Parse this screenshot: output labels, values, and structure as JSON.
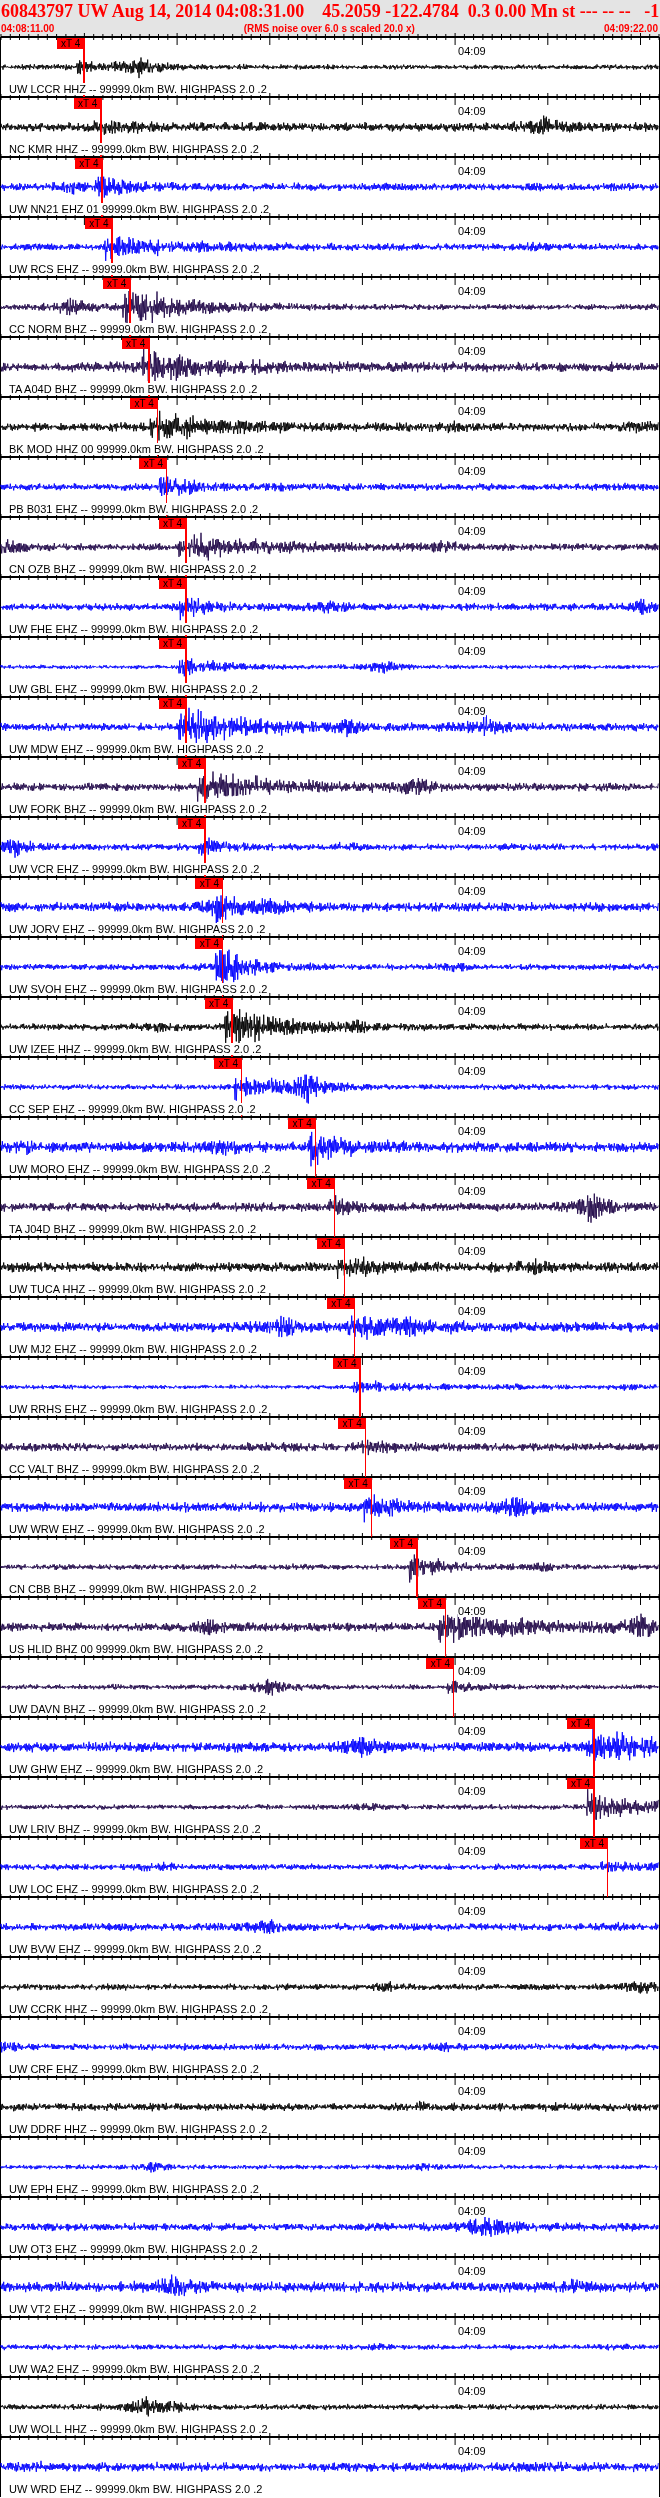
{
  "header": {
    "title": "60843797 UW Aug 14, 2014 04:08:31.00    45.2059 -122.4784  0.3 0.00 Mn st --- -- --   -1",
    "start_time": "04:08:11.00",
    "note": "(RMS noise over 6.0 s scaled 20.0 x)",
    "end_time": "04:09:22.00"
  },
  "traces": [
    {
      "label": "UW LCCR HHZ -- 99999.0km BW. HIGHPASS 2.0 .2",
      "color": "#000000",
      "time_mark": "04:09",
      "pick": {
        "label": "xT 4",
        "level": 0.127
      }
    },
    {
      "label": "NC KMR HHZ -- 99999.0km BW. HIGHPASS 2.0 .2",
      "color": "#000000",
      "time_mark": "04:09",
      "pick": {
        "label": "xT 4",
        "level": 0.153
      }
    },
    {
      "label": "UW NN21 EHZ 01 99999.0km BW. HIGHPASS 2.0 .2",
      "color": "#0000ff",
      "time_mark": "04:09",
      "pick": {
        "label": "xT 4",
        "level": 0.155
      }
    },
    {
      "label": "UW RCS EHZ -- 99999.0km BW. HIGHPASS 2.0 .2",
      "color": "#0000ff",
      "time_mark": "04:09",
      "pick": {
        "label": "xT 4",
        "level": 0.17
      }
    },
    {
      "label": "CC NORM BHZ -- 99999.0km BW. HIGHPASS 2.0 .2",
      "color": "#200848",
      "time_mark": "04:09",
      "pick": {
        "label": "xT 4",
        "level": 0.197
      }
    },
    {
      "label": "TA A04D BHZ -- 99999.0km BW. HIGHPASS 2.0 .2",
      "color": "#200848",
      "time_mark": "04:09",
      "pick": {
        "label": "xT 4",
        "level": 0.226
      }
    },
    {
      "label": "BK MOD HHZ 00 99999.0km BW. HIGHPASS 2.0 .2",
      "color": "#000000",
      "time_mark": "04:09",
      "pick": {
        "label": "xT 4",
        "level": 0.239
      }
    },
    {
      "label": "PB B031 EHZ -- 99999.0km BW. HIGHPASS 2.0 .2",
      "color": "#0000ff",
      "time_mark": "04:09",
      "pick": {
        "label": "xT 4",
        "level": 0.253
      }
    },
    {
      "label": "CN OZB BHZ -- 99999.0km BW. HIGHPASS 2.0 .2",
      "color": "#200848",
      "time_mark": "04:09",
      "pick": {
        "label": "xT 4",
        "level": 0.282
      }
    },
    {
      "label": "UW FHE EHZ -- 99999.0km BW. HIGHPASS 2.0 .2",
      "color": "#0000ff",
      "time_mark": "04:09",
      "pick": {
        "label": "xT 4",
        "level": 0.282
      }
    },
    {
      "label": "UW GBL EHZ -- 99999.0km BW. HIGHPASS 2.0 .2",
      "color": "#0000ff",
      "time_mark": "04:09",
      "pick": {
        "label": "xT 4",
        "level": 0.282
      }
    },
    {
      "label": "UW MDW EHZ -- 99999.0km BW. HIGHPASS 2.0 .2",
      "color": "#0000ff",
      "time_mark": "04:09",
      "pick": {
        "label": "xT 4",
        "level": 0.282
      }
    },
    {
      "label": "UW FORK BHZ -- 99999.0km BW. HIGHPASS 2.0 .2",
      "color": "#200848",
      "time_mark": "04:09",
      "pick": {
        "label": "xT 4",
        "level": 0.311
      }
    },
    {
      "label": "UW VCR EHZ -- 99999.0km BW. HIGHPASS 2.0 .2",
      "color": "#0000ff",
      "time_mark": "04:09",
      "pick": {
        "label": "xT 4",
        "level": 0.311
      }
    },
    {
      "label": "UW JORV EHZ -- 99999.0km BW. HIGHPASS 2.0 .2",
      "color": "#0000ff",
      "time_mark": "04:09",
      "pick": {
        "label": "xT 4",
        "level": 0.338
      }
    },
    {
      "label": "UW SVOH EHZ -- 99999.0km BW. HIGHPASS 2.0 .2",
      "color": "#0000ff",
      "time_mark": "04:09",
      "pick": {
        "label": "xT 4",
        "level": 0.338
      }
    },
    {
      "label": "UW IZEE HHZ -- 99999.0km BW. HIGHPASS 2.0 .2",
      "color": "#000000",
      "time_mark": "04:09",
      "pick": {
        "label": "xT 4",
        "level": 0.352
      }
    },
    {
      "label": "CC SEP EHZ -- 99999.0km BW. HIGHPASS 2.0 .2",
      "color": "#0000ff",
      "time_mark": "04:09",
      "pick": {
        "label": "xT 4",
        "level": 0.367
      }
    },
    {
      "label": "UW MORO EHZ -- 99999.0km BW. HIGHPASS 2.0 .2",
      "color": "#0000ff",
      "time_mark": "04:09",
      "pick": {
        "label": "xT 4",
        "level": 0.479
      }
    },
    {
      "label": "TA J04D BHZ -- 99999.0km BW. HIGHPASS 2.0 .2",
      "color": "#200848",
      "time_mark": "04:09",
      "pick": {
        "label": "xT 4",
        "level": 0.508
      }
    },
    {
      "label": "UW TUCA HHZ -- 99999.0km BW. HIGHPASS 2.0 .2",
      "color": "#000000",
      "time_mark": "04:09",
      "pick": {
        "label": "xT 4",
        "level": 0.523
      }
    },
    {
      "label": "UW MJ2 EHZ -- 99999.0km BW. HIGHPASS 2.0 .2",
      "color": "#0000ff",
      "time_mark": "04:09",
      "pick": {
        "label": "xT 4",
        "level": 0.538
      }
    },
    {
      "label": "UW RRHS EHZ -- 99999.0km BW. HIGHPASS 2.0 .2",
      "color": "#0000ff",
      "time_mark": "04:09",
      "pick": {
        "label": "xT 4",
        "level": 0.547
      }
    },
    {
      "label": "CC VALT BHZ -- 99999.0km BW. HIGHPASS 2.0 .2",
      "color": "#200848",
      "time_mark": "04:09",
      "pick": {
        "label": "xT 4",
        "level": 0.555
      }
    },
    {
      "label": "UW WRW EHZ -- 99999.0km BW. HIGHPASS 2.0 .2",
      "color": "#0000ff",
      "time_mark": "04:09",
      "pick": {
        "label": "xT 4",
        "level": 0.564
      }
    },
    {
      "label": "CN CBB BHZ -- 99999.0km BW. HIGHPASS 2.0 .2",
      "color": "#200848",
      "time_mark": "04:09",
      "pick": {
        "label": "xT 4",
        "level": 0.633
      }
    },
    {
      "label": "US HLID BHZ 00 99999.0km BW. HIGHPASS 2.0 .2",
      "color": "#200848",
      "time_mark": "04:09",
      "pick": {
        "label": "xT 4",
        "level": 0.677
      }
    },
    {
      "label": "UW DAVN BHZ -- 99999.0km BW. HIGHPASS 2.0 .2",
      "color": "#200848",
      "time_mark": "04:09",
      "pick": {
        "label": "xT 4",
        "level": 0.689
      }
    },
    {
      "label": "UW GHW EHZ -- 99999.0km BW. HIGHPASS 2.0 .2",
      "color": "#0000ff",
      "time_mark": "04:09",
      "pick": {
        "label": "xT 4",
        "level": 0.902
      }
    },
    {
      "label": "UW LRIV BHZ -- 99999.0km BW. HIGHPASS 2.0 .2",
      "color": "#200848",
      "time_mark": "04:09",
      "pick": {
        "label": "xT 4",
        "level": 0.902
      }
    },
    {
      "label": "UW LOC EHZ -- 99999.0km BW. HIGHPASS 2.0 .2",
      "color": "#0000ff",
      "time_mark": "04:09",
      "pick": {
        "label": "xT 4",
        "level": 0.923
      }
    },
    {
      "label": "UW BVW EHZ -- 99999.0km BW. HIGHPASS 2.0 .2",
      "color": "#0000ff",
      "time_mark": "04:09"
    },
    {
      "label": "UW CCRK HHZ -- 99999.0km BW. HIGHPASS 2.0 .2",
      "color": "#000000",
      "time_mark": "04:09"
    },
    {
      "label": "UW CRF EHZ -- 99999.0km BW. HIGHPASS 2.0 .2",
      "color": "#0000ff",
      "time_mark": "04:09"
    },
    {
      "label": "UW DDRF HHZ -- 99999.0km BW. HIGHPASS 2.0 .2",
      "color": "#000000",
      "time_mark": "04:09"
    },
    {
      "label": "UW EPH EHZ -- 99999.0km BW. HIGHPASS 2.0 .2",
      "color": "#0000ff",
      "time_mark": "04:09"
    },
    {
      "label": "UW OT3 EHZ -- 99999.0km BW. HIGHPASS 2.0 .2",
      "color": "#0000ff",
      "time_mark": "04:09"
    },
    {
      "label": "UW VT2 EHZ -- 99999.0km BW. HIGHPASS 2.0 .2",
      "color": "#0000ff",
      "time_mark": "04:09"
    },
    {
      "label": "UW WA2 EHZ -- 99999.0km BW. HIGHPASS 2.0 .2",
      "color": "#0000ff",
      "time_mark": "04:09"
    },
    {
      "label": "UW WOLL HHZ -- 99999.0km BW. HIGHPASS 2.0 .2",
      "color": "#000000",
      "time_mark": "04:09"
    },
    {
      "label": "UW WRD EHZ -- 99999.0km BW. HIGHPASS 2.0 .2",
      "color": "#0000ff",
      "time_mark": "04:09"
    }
  ]
}
